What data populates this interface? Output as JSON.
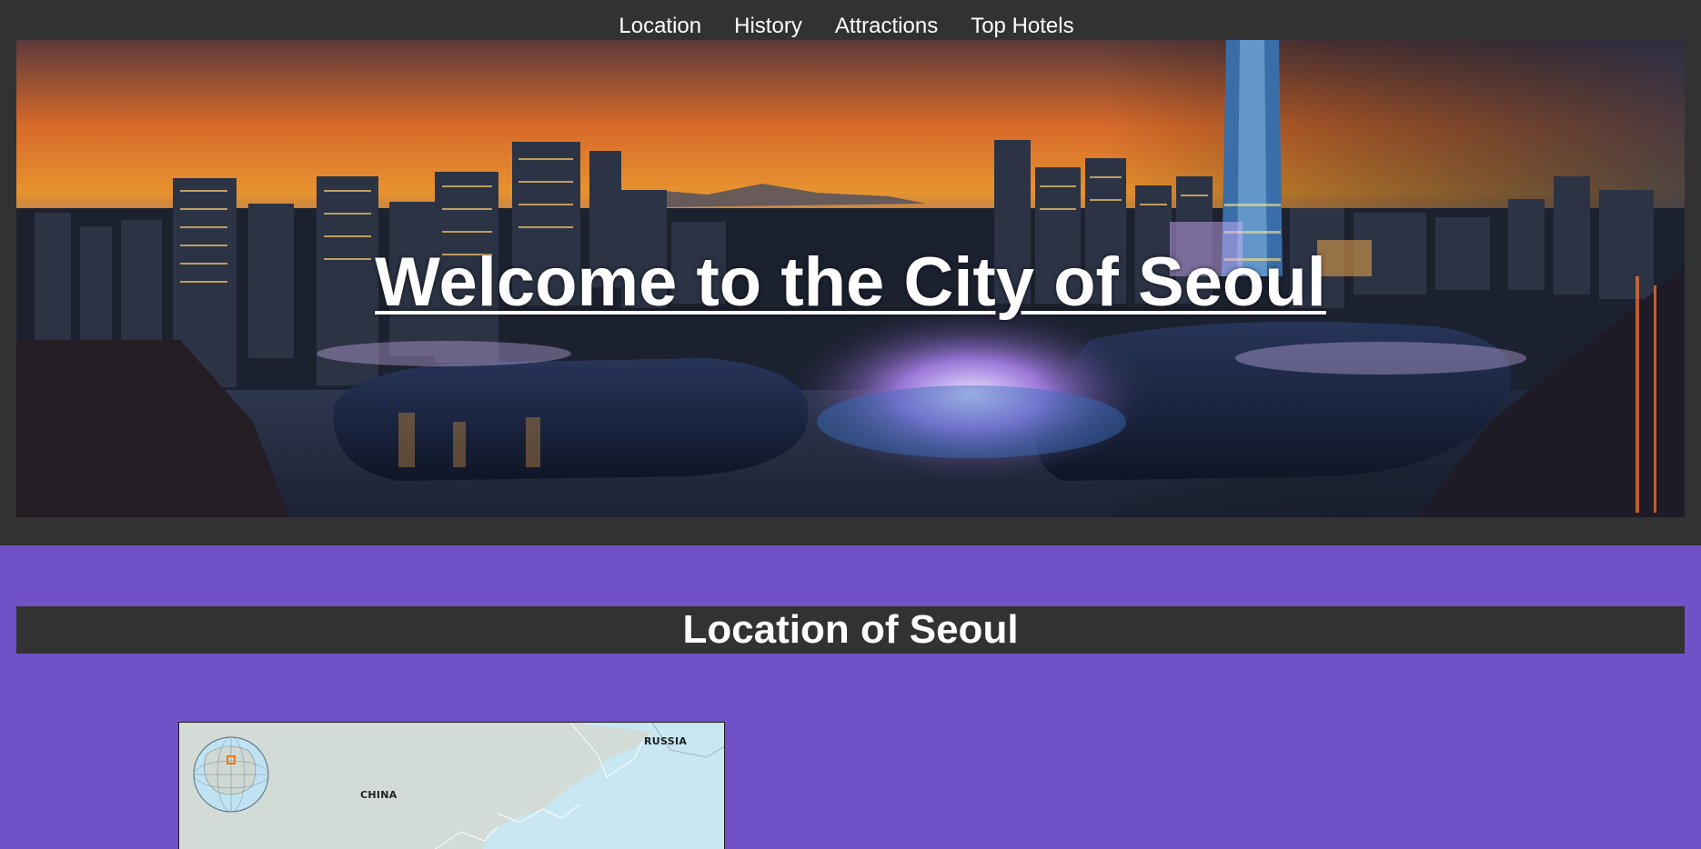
{
  "nav": {
    "items": [
      {
        "label": "Location"
      },
      {
        "label": "History"
      },
      {
        "label": "Attractions"
      },
      {
        "label": "Top Hotels"
      }
    ]
  },
  "hero": {
    "title": "Welcome to the City of Seoul",
    "image": "seoul-night-skyline-photo"
  },
  "location_section": {
    "title": "Location of Seoul",
    "map": {
      "labels": {
        "russia": "RUSSIA",
        "china": "CHINA"
      },
      "inset": "globe-locator-icon"
    }
  },
  "colors": {
    "page_background": "#7051c8",
    "header_background": "#323232",
    "text": "#ffffff",
    "map_land": "#d3dbd7",
    "map_sea": "#c8e7f3",
    "map_highlight": "#e87a1e"
  }
}
